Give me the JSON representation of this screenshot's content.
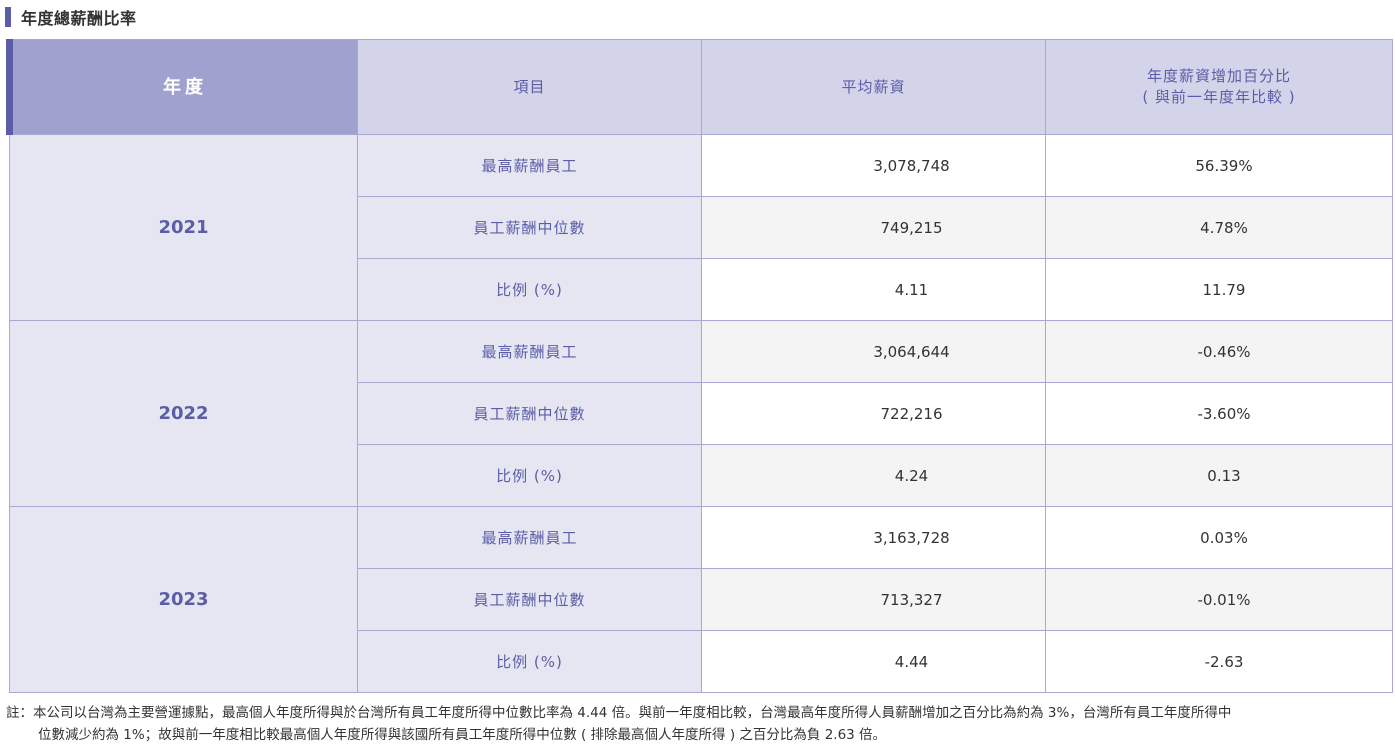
{
  "section": {
    "title": "年度總薪酬比率"
  },
  "table": {
    "headers": {
      "year": "年度",
      "item": "項目",
      "avg": "平均薪資",
      "pct_line1": "年度薪資增加百分比",
      "pct_line2": "( 與前一年度年比較 )"
    },
    "groups": [
      {
        "year": "2021",
        "rows": [
          {
            "item": "最高薪酬員工",
            "avg": "3,078,748",
            "pct": "56.39%"
          },
          {
            "item": "員工薪酬中位數",
            "avg": "749,215",
            "pct": "4.78%"
          },
          {
            "item": "比例 (%)",
            "avg": "4.11",
            "pct": "11.79"
          }
        ]
      },
      {
        "year": "2022",
        "rows": [
          {
            "item": "最高薪酬員工",
            "avg": "3,064,644",
            "pct": "-0.46%"
          },
          {
            "item": "員工薪酬中位數",
            "avg": "722,216",
            "pct": "-3.60%"
          },
          {
            "item": "比例 (%)",
            "avg": "4.24",
            "pct": "0.13"
          }
        ]
      },
      {
        "year": "2023",
        "rows": [
          {
            "item": "最高薪酬員工",
            "avg": "3,163,728",
            "pct": "0.03%"
          },
          {
            "item": "員工薪酬中位數",
            "avg": "713,327",
            "pct": "-0.01%"
          },
          {
            "item": "比例 (%)",
            "avg": "4.44",
            "pct": "-2.63"
          }
        ]
      }
    ]
  },
  "note": {
    "line1": "註：本公司以台灣為主要營運據點，最高個人年度所得與於台灣所有員工年度所得中位數比率為 4.44 倍。與前一年度相比較，台灣最高年度所得人員薪酬增加之百分比為約為 3%，台灣所有員工年度所得中",
    "line2": "位數減少約為 1%；故與前一年度相比較最高個人年度所得與該國所有員工年度所得中位數 ( 排除最高個人年度所得 ) 之百分比為負 2.63 倍。"
  }
}
